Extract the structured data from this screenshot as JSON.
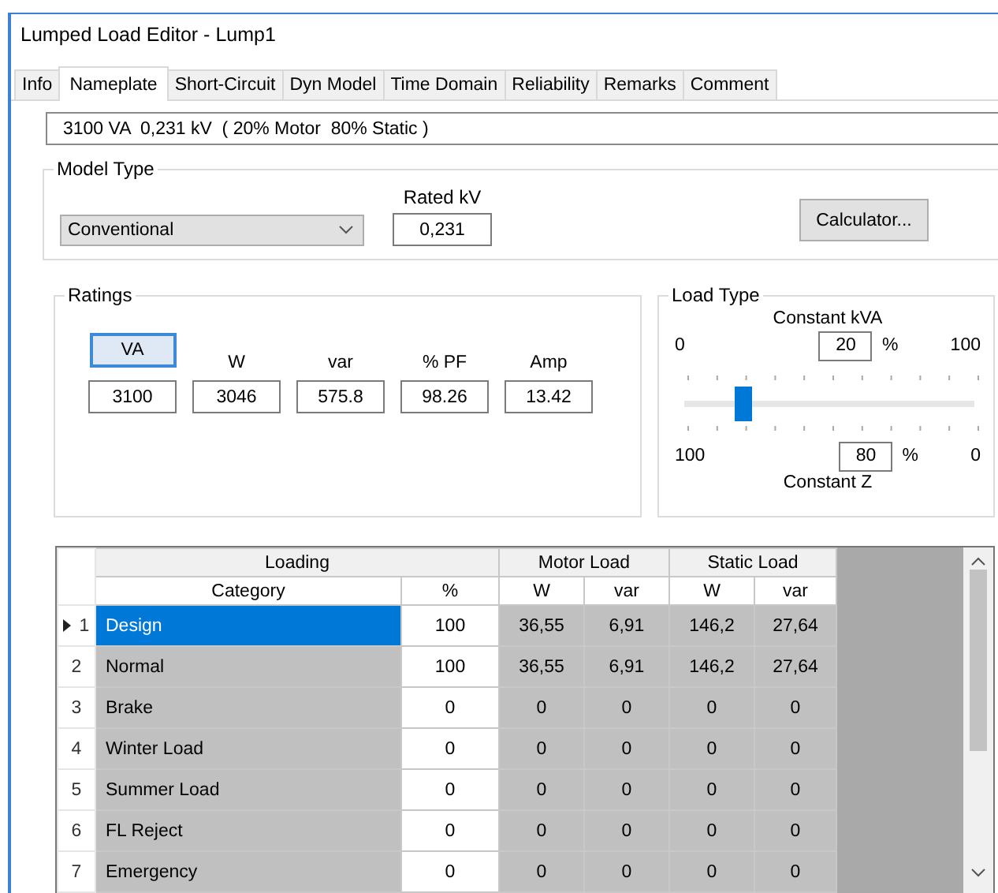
{
  "window": {
    "title": "Lumped Load Editor - Lump1"
  },
  "tabs": [
    {
      "label": "Info",
      "selected": false
    },
    {
      "label": "Nameplate",
      "selected": true
    },
    {
      "label": "Short-Circuit",
      "selected": false
    },
    {
      "label": "Dyn Model",
      "selected": false
    },
    {
      "label": "Time Domain",
      "selected": false
    },
    {
      "label": "Reliability",
      "selected": false
    },
    {
      "label": "Remarks",
      "selected": false
    },
    {
      "label": "Comment",
      "selected": false
    }
  ],
  "summary": {
    "value": "3100 VA  0,231 kV  ( 20% Motor  80% Static )"
  },
  "model_type": {
    "title": "Model Type",
    "dropdown": {
      "value": "Conventional"
    },
    "rated_kv": {
      "label": "Rated kV",
      "value": "0,231"
    },
    "calculator_button": "Calculator..."
  },
  "ratings": {
    "title": "Ratings",
    "columns": [
      {
        "label": "VA",
        "kind": "button",
        "selected": true,
        "value": "3100"
      },
      {
        "label": "W",
        "kind": "label",
        "value": "3046"
      },
      {
        "label": "var",
        "kind": "label",
        "value": "575.8"
      },
      {
        "label": "% PF",
        "kind": "label",
        "value": "98.26"
      },
      {
        "label": "Amp",
        "kind": "label",
        "value": "13.42"
      }
    ]
  },
  "load_type": {
    "title": "Load Type",
    "top": {
      "label": "Constant kVA",
      "min": "0",
      "value": "20",
      "unit": "%",
      "max": "100"
    },
    "slider": {
      "level": 0.2
    },
    "bottom": {
      "label": "Constant Z",
      "min": "100",
      "value": "80",
      "unit": "%",
      "max": "0"
    }
  },
  "grid": {
    "column_groups": [
      {
        "label": "Loading",
        "columns": [
          "Category",
          "%"
        ]
      },
      {
        "label": "Motor Load",
        "columns": [
          "W",
          "var"
        ]
      },
      {
        "label": "Static Load",
        "columns": [
          "W",
          "var"
        ]
      }
    ],
    "rows": [
      {
        "number": "1",
        "selected": true,
        "cells": [
          "Design",
          "100",
          "36,55",
          "6,91",
          "146,2",
          "27,64"
        ]
      },
      {
        "number": "2",
        "selected": false,
        "cells": [
          "Normal",
          "100",
          "36,55",
          "6,91",
          "146,2",
          "27,64"
        ]
      },
      {
        "number": "3",
        "selected": false,
        "cells": [
          "Brake",
          "0",
          "0",
          "0",
          "0",
          "0"
        ]
      },
      {
        "number": "4",
        "selected": false,
        "cells": [
          "Winter Load",
          "0",
          "0",
          "0",
          "0",
          "0"
        ]
      },
      {
        "number": "5",
        "selected": false,
        "cells": [
          "Summer Load",
          "0",
          "0",
          "0",
          "0",
          "0"
        ]
      },
      {
        "number": "6",
        "selected": false,
        "cells": [
          "FL Reject",
          "0",
          "0",
          "0",
          "0",
          "0"
        ]
      },
      {
        "number": "7",
        "selected": false,
        "cells": [
          "Emergency",
          "0",
          "0",
          "0",
          "0",
          "0"
        ]
      }
    ]
  }
}
